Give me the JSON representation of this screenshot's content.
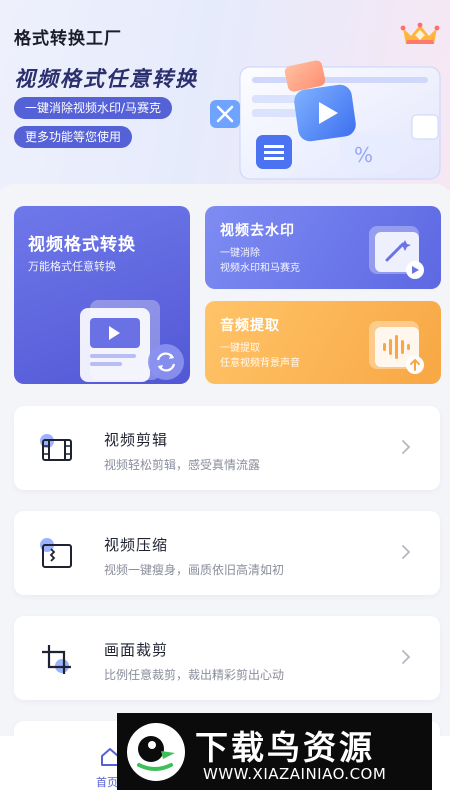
{
  "header": {
    "app_title": "格式转换工厂",
    "crown_icon": "crown-icon"
  },
  "banner": {
    "headline": "视频格式任意转换",
    "tags": [
      "一键消除视频水印/马赛克",
      "更多功能等您使用"
    ]
  },
  "feature_cards": {
    "main": {
      "title": "视频格式转换",
      "subtitle": "万能格式任意转换",
      "icon": "video-document-icon"
    },
    "watermark": {
      "title": "视频去水印",
      "subtitle": "一键消除\n视频水印和马赛克",
      "icon": "magic-wand-icon"
    },
    "audio": {
      "title": "音频提取",
      "subtitle": "一键提取\n任意视频背景声音",
      "icon": "audio-wave-icon"
    }
  },
  "tools": [
    {
      "title": "视频剪辑",
      "subtitle": "视频轻松剪辑，感受真情流露",
      "icon": "film-strip-icon"
    },
    {
      "title": "视频压缩",
      "subtitle": "视频一键瘦身，画质依旧高清如初",
      "icon": "compress-icon"
    },
    {
      "title": "画面裁剪",
      "subtitle": "比例任意裁剪，裁出精彩剪出心动",
      "icon": "crop-icon"
    }
  ],
  "bottom_nav": {
    "home_label": "首页"
  },
  "watermark": {
    "brand": "下载鸟资源",
    "url": "WWW.XIAZAINIAO.COM"
  },
  "colors": {
    "primary": "#5561d6",
    "card_blue": "#6f78ea",
    "card_orange": "#f8a744",
    "background": "#f4f5f9"
  }
}
